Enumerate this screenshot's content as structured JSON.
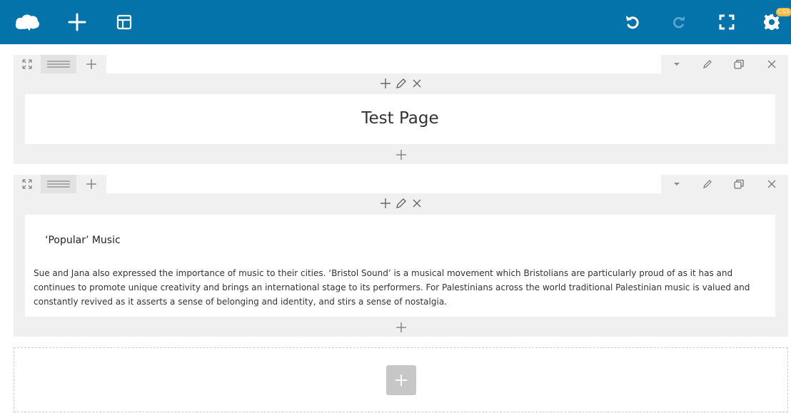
{
  "toolbar": {
    "logo_icon": "cloud-icon",
    "add_icon": "plus-icon",
    "layout_icon": "layout-icon",
    "undo_icon": "undo-icon",
    "redo_icon": "redo-icon",
    "fullscreen_icon": "fullscreen-icon",
    "settings_icon": "gear-icon",
    "css_badge": "CSS",
    "colors": {
      "bar": "#0373aa",
      "badge": "#f4b73a"
    }
  },
  "rows": [
    {
      "heading": "Test Page"
    },
    {
      "subheading": "‘Popular’ Music",
      "paragraph": "Sue and Jana also expressed the importance of music to their cities. ‘Bristol Sound’ is a musical movement which Bristolians are particularly proud of as it has and continues to promote unique creativity and brings an international stage to its performers. For Palestinians across the world traditional Palestinian music is valued and constantly revived as it asserts a sense of belonging and identity, and stirs a sense of nostalgia."
    }
  ]
}
